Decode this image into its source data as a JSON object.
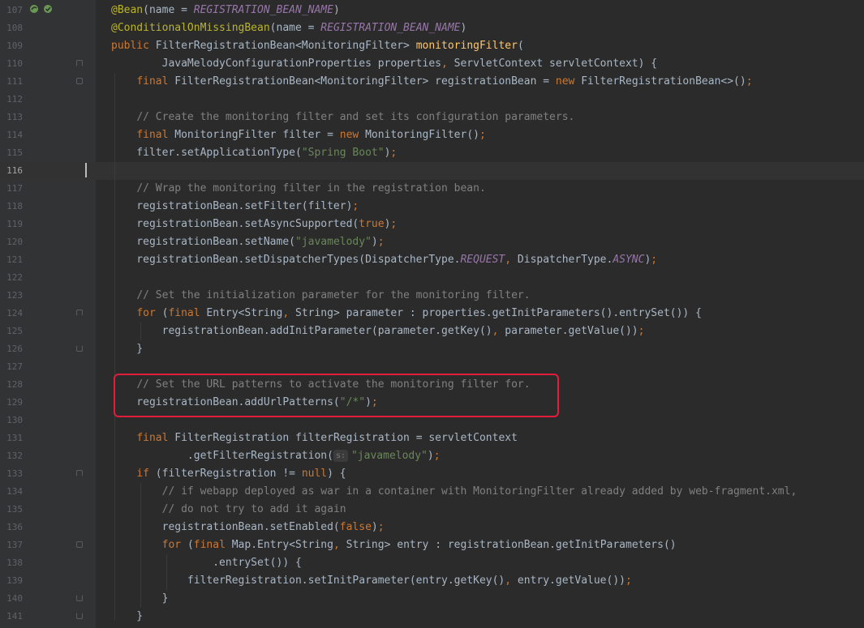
{
  "editor": {
    "lines": [
      {
        "num": "107",
        "tokens": [
          {
            "c": "t-annot",
            "t": "@Bean"
          },
          {
            "c": "",
            "t": "(name = "
          },
          {
            "c": "t-const",
            "t": "REGISTRATION_BEAN_NAME"
          },
          {
            "c": "",
            "t": ")"
          }
        ]
      },
      {
        "num": "108",
        "tokens": [
          {
            "c": "t-annot",
            "t": "@ConditionalOnMissingBean"
          },
          {
            "c": "",
            "t": "(name = "
          },
          {
            "c": "t-const",
            "t": "REGISTRATION_BEAN_NAME"
          },
          {
            "c": "",
            "t": ")"
          }
        ]
      },
      {
        "num": "109",
        "tokens": [
          {
            "c": "t-kw",
            "t": "public "
          },
          {
            "c": "",
            "t": "FilterRegistrationBean<MonitoringFilter> "
          },
          {
            "c": "t-method",
            "t": "monitoringFilter"
          },
          {
            "c": "",
            "t": "("
          }
        ]
      },
      {
        "num": "110",
        "tokens": [
          {
            "c": "",
            "t": "        JavaMelodyConfigurationProperties properties"
          },
          {
            "c": "t-kw",
            "t": ", "
          },
          {
            "c": "",
            "t": "ServletContext servletContext) {"
          }
        ]
      },
      {
        "num": "111",
        "tokens": [
          {
            "c": "",
            "t": "    "
          },
          {
            "c": "t-kw",
            "t": "final "
          },
          {
            "c": "",
            "t": "FilterRegistrationBean<MonitoringFilter> registrationBean = "
          },
          {
            "c": "t-kw",
            "t": "new "
          },
          {
            "c": "",
            "t": "FilterRegistrationBean<>()"
          },
          {
            "c": "t-kw",
            "t": ";"
          }
        ]
      },
      {
        "num": "112",
        "tokens": []
      },
      {
        "num": "113",
        "tokens": [
          {
            "c": "",
            "t": "    "
          },
          {
            "c": "t-comment",
            "t": "// Create the monitoring filter and set its configuration parameters."
          }
        ]
      },
      {
        "num": "114",
        "tokens": [
          {
            "c": "",
            "t": "    "
          },
          {
            "c": "t-kw",
            "t": "final "
          },
          {
            "c": "",
            "t": "MonitoringFilter filter = "
          },
          {
            "c": "t-kw",
            "t": "new "
          },
          {
            "c": "",
            "t": "MonitoringFilter()"
          },
          {
            "c": "t-kw",
            "t": ";"
          }
        ]
      },
      {
        "num": "115",
        "tokens": [
          {
            "c": "",
            "t": "    filter.setApplicationType("
          },
          {
            "c": "t-str",
            "t": "\"Spring Boot\""
          },
          {
            "c": "",
            "t": ")"
          },
          {
            "c": "t-kw",
            "t": ";"
          }
        ]
      },
      {
        "num": "116",
        "tokens": []
      },
      {
        "num": "117",
        "tokens": [
          {
            "c": "",
            "t": "    "
          },
          {
            "c": "t-comment",
            "t": "// Wrap the monitoring filter in the registration bean."
          }
        ]
      },
      {
        "num": "118",
        "tokens": [
          {
            "c": "",
            "t": "    registrationBean.setFilter(filter)"
          },
          {
            "c": "t-kw",
            "t": ";"
          }
        ]
      },
      {
        "num": "119",
        "tokens": [
          {
            "c": "",
            "t": "    registrationBean.setAsyncSupported("
          },
          {
            "c": "t-kw",
            "t": "true"
          },
          {
            "c": "",
            "t": ")"
          },
          {
            "c": "t-kw",
            "t": ";"
          }
        ]
      },
      {
        "num": "120",
        "tokens": [
          {
            "c": "",
            "t": "    registrationBean.setName("
          },
          {
            "c": "t-str",
            "t": "\"javamelody\""
          },
          {
            "c": "",
            "t": ")"
          },
          {
            "c": "t-kw",
            "t": ";"
          }
        ]
      },
      {
        "num": "121",
        "tokens": [
          {
            "c": "",
            "t": "    registrationBean.setDispatcherTypes(DispatcherType."
          },
          {
            "c": "t-const",
            "t": "REQUEST"
          },
          {
            "c": "t-kw",
            "t": ", "
          },
          {
            "c": "",
            "t": "DispatcherType."
          },
          {
            "c": "t-const",
            "t": "ASYNC"
          },
          {
            "c": "",
            "t": ")"
          },
          {
            "c": "t-kw",
            "t": ";"
          }
        ]
      },
      {
        "num": "122",
        "tokens": []
      },
      {
        "num": "123",
        "tokens": [
          {
            "c": "",
            "t": "    "
          },
          {
            "c": "t-comment",
            "t": "// Set the initialization parameter for the monitoring filter."
          }
        ]
      },
      {
        "num": "124",
        "tokens": [
          {
            "c": "",
            "t": "    "
          },
          {
            "c": "t-kw",
            "t": "for "
          },
          {
            "c": "",
            "t": "("
          },
          {
            "c": "t-kw",
            "t": "final "
          },
          {
            "c": "",
            "t": "Entry<String"
          },
          {
            "c": "t-kw",
            "t": ", "
          },
          {
            "c": "",
            "t": "String> parameter : properties.getInitParameters().entrySet()) {"
          }
        ]
      },
      {
        "num": "125",
        "tokens": [
          {
            "c": "",
            "t": "        registrationBean.addInitParameter(parameter.getKey()"
          },
          {
            "c": "t-kw",
            "t": ", "
          },
          {
            "c": "",
            "t": "parameter.getValue())"
          },
          {
            "c": "t-kw",
            "t": ";"
          }
        ]
      },
      {
        "num": "126",
        "tokens": [
          {
            "c": "",
            "t": "    }"
          }
        ]
      },
      {
        "num": "127",
        "tokens": []
      },
      {
        "num": "128",
        "tokens": [
          {
            "c": "",
            "t": "    "
          },
          {
            "c": "t-comment",
            "t": "// Set the URL patterns to activate the monitoring filter for."
          }
        ]
      },
      {
        "num": "129",
        "tokens": [
          {
            "c": "",
            "t": "    registrationBean.addUrlPatterns("
          },
          {
            "c": "t-str",
            "t": "\"/*\""
          },
          {
            "c": "",
            "t": ")"
          },
          {
            "c": "t-kw",
            "t": ";"
          }
        ]
      },
      {
        "num": "130",
        "tokens": []
      },
      {
        "num": "131",
        "tokens": [
          {
            "c": "",
            "t": "    "
          },
          {
            "c": "t-kw",
            "t": "final "
          },
          {
            "c": "",
            "t": "FilterRegistration filterRegistration = servletContext"
          }
        ]
      },
      {
        "num": "132",
        "tokens": [
          {
            "c": "",
            "t": "            .getFilterRegistration("
          },
          {
            "c": "t-hint",
            "t": "s:"
          },
          {
            "c": "t-str",
            "t": "\"javamelody\""
          },
          {
            "c": "",
            "t": ")"
          },
          {
            "c": "t-kw",
            "t": ";"
          }
        ]
      },
      {
        "num": "133",
        "tokens": [
          {
            "c": "",
            "t": "    "
          },
          {
            "c": "t-kw",
            "t": "if "
          },
          {
            "c": "",
            "t": "(filterRegistration != "
          },
          {
            "c": "t-kw",
            "t": "null"
          },
          {
            "c": "",
            "t": ") {"
          }
        ]
      },
      {
        "num": "134",
        "tokens": [
          {
            "c": "",
            "t": "        "
          },
          {
            "c": "t-comment",
            "t": "// if webapp deployed as war in a container with MonitoringFilter already added by web-fragment.xml,"
          }
        ]
      },
      {
        "num": "135",
        "tokens": [
          {
            "c": "",
            "t": "        "
          },
          {
            "c": "t-comment",
            "t": "// do not try to add it again"
          }
        ]
      },
      {
        "num": "136",
        "tokens": [
          {
            "c": "",
            "t": "        registrationBean.setEnabled("
          },
          {
            "c": "t-kw",
            "t": "false"
          },
          {
            "c": "",
            "t": ")"
          },
          {
            "c": "t-kw",
            "t": ";"
          }
        ]
      },
      {
        "num": "137",
        "tokens": [
          {
            "c": "",
            "t": "        "
          },
          {
            "c": "t-kw",
            "t": "for "
          },
          {
            "c": "",
            "t": "("
          },
          {
            "c": "t-kw",
            "t": "final "
          },
          {
            "c": "",
            "t": "Map.Entry<String"
          },
          {
            "c": "t-kw",
            "t": ", "
          },
          {
            "c": "",
            "t": "String> entry : registrationBean.getInitParameters()"
          }
        ]
      },
      {
        "num": "138",
        "tokens": [
          {
            "c": "",
            "t": "                .entrySet()) {"
          }
        ]
      },
      {
        "num": "139",
        "tokens": [
          {
            "c": "",
            "t": "            filterRegistration.setInitParameter(entry.getKey()"
          },
          {
            "c": "t-kw",
            "t": ", "
          },
          {
            "c": "",
            "t": "entry.getValue())"
          },
          {
            "c": "t-kw",
            "t": ";"
          }
        ]
      },
      {
        "num": "140",
        "tokens": [
          {
            "c": "",
            "t": "        }"
          }
        ]
      },
      {
        "num": "141",
        "tokens": [
          {
            "c": "",
            "t": "    }"
          }
        ]
      }
    ],
    "current_line": "116",
    "fold_markers": {
      "110": "up",
      "111": "",
      "124": "up",
      "126": "down",
      "133": "up",
      "137": "",
      "140": "down",
      "141": "down"
    },
    "highlight_color": "#e11d3a",
    "gutter_icons": [
      "bean-run-icon",
      "bean-navigate-icon"
    ]
  }
}
